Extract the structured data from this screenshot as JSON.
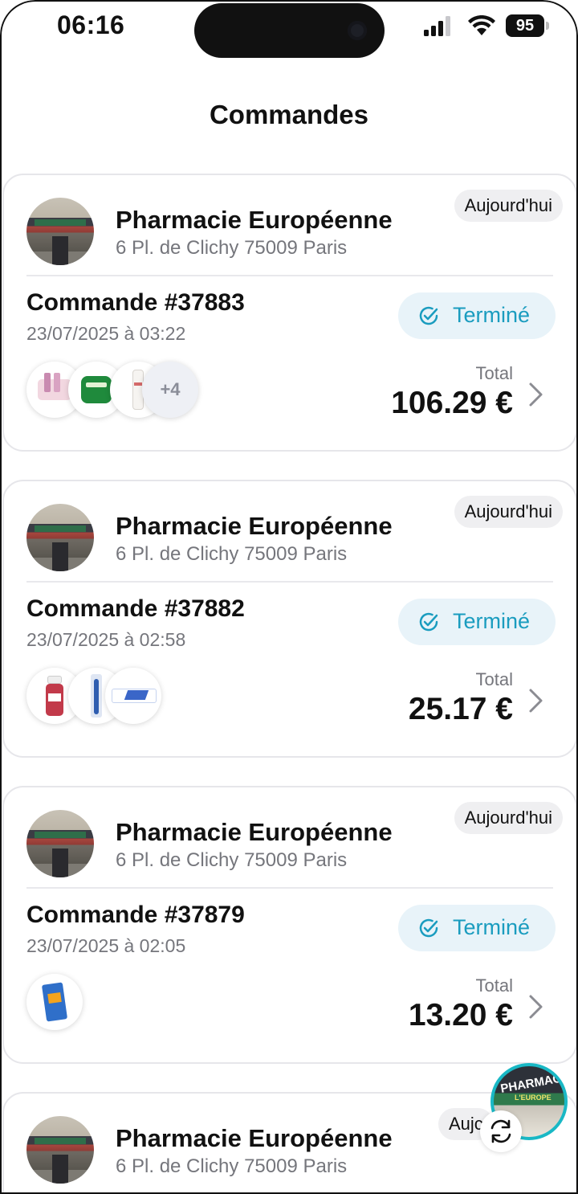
{
  "status_bar": {
    "time": "06:16",
    "battery": "95",
    "icons": [
      "signal-icon",
      "wifi-icon",
      "battery-icon"
    ]
  },
  "header": {
    "title": "Commandes"
  },
  "colors": {
    "accent": "#1a9cbf",
    "status_bg": "#e8f3f9",
    "fab_ring": "#19b8c5"
  },
  "orders": [
    {
      "pharmacy_name": "Pharmacie Européenne",
      "pharmacy_address": "6 Pl. de Clichy 75009 Paris",
      "date_badge": "Aujourd'hui",
      "order_number": "Commande #37883",
      "order_datetime": "23/07/2025 à 03:22",
      "status": "Terminé",
      "products": [
        "skincare-kit-icon",
        "green-jar-icon",
        "white-tube-icon"
      ],
      "more_count": "+4",
      "total_label": "Total",
      "total_value": "106.29 €"
    },
    {
      "pharmacy_name": "Pharmacie Européenne",
      "pharmacy_address": "6 Pl. de Clichy 75009 Paris",
      "date_badge": "Aujourd'hui",
      "order_number": "Commande #37882",
      "order_datetime": "23/07/2025 à 02:58",
      "status": "Terminé",
      "products": [
        "mouthwash-icon",
        "toothbrush-icon",
        "toothpaste-icon"
      ],
      "total_label": "Total",
      "total_value": "25.17 €"
    },
    {
      "pharmacy_name": "Pharmacie Européenne",
      "pharmacy_address": "6 Pl. de Clichy 75009 Paris",
      "date_badge": "Aujourd'hui",
      "order_number": "Commande #37879",
      "order_datetime": "23/07/2025 à 02:05",
      "status": "Terminé",
      "products": [
        "box-product-icon"
      ],
      "total_label": "Total",
      "total_value": "13.20 €"
    },
    {
      "pharmacy_name": "Pharmacie Européenne",
      "pharmacy_address": "6 Pl. de Clichy 75009 Paris",
      "date_badge": "Aujc"
    }
  ],
  "fab": {
    "text": "PHARMACIE",
    "subtext": "L'EUROPE"
  }
}
